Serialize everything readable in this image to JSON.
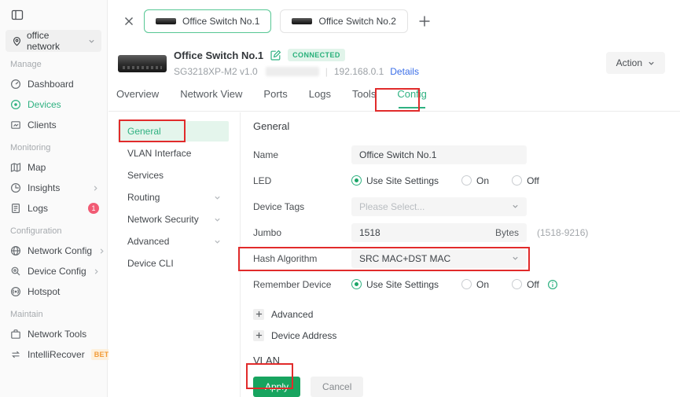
{
  "colors": {
    "accent_green": "#2fb181",
    "button_green": "#18a45f",
    "badge_green_bg": "#e1f4ea",
    "annotation_red": "#e12b2b",
    "logs_badge_red": "#f15b74",
    "beta_orange": "#f29b38",
    "link_blue": "#3a6ee8",
    "sidebar_bg": "#fafafa",
    "field_bg": "#f5f5f5"
  },
  "sidebar": {
    "site": {
      "label": "office network"
    },
    "sections": [
      {
        "label": "Manage",
        "items": [
          {
            "label": "Dashboard"
          },
          {
            "label": "Devices"
          },
          {
            "label": "Clients"
          }
        ]
      },
      {
        "label": "Monitoring",
        "items": [
          {
            "label": "Map"
          },
          {
            "label": "Insights"
          },
          {
            "label": "Logs",
            "badge": "1"
          }
        ]
      },
      {
        "label": "Configuration",
        "items": [
          {
            "label": "Network Config"
          },
          {
            "label": "Device Config"
          },
          {
            "label": "Hotspot"
          }
        ]
      },
      {
        "label": "Maintain",
        "items": [
          {
            "label": "Network Tools"
          },
          {
            "label": "IntelliRecover",
            "beta": "BETA"
          }
        ]
      }
    ]
  },
  "device_tabs": {
    "tabs": [
      {
        "label": "Office Switch No.1",
        "active": true
      },
      {
        "label": "Office Switch No.2",
        "active": false
      }
    ]
  },
  "device_header": {
    "name": "Office Switch No.1",
    "status": "CONNECTED",
    "model": "SG3218XP-M2 v1.0",
    "separator": "|",
    "ip": "192.168.0.1",
    "details_label": "Details",
    "action_label": "Action"
  },
  "page_tabs": {
    "items": [
      {
        "label": "Overview"
      },
      {
        "label": "Network View"
      },
      {
        "label": "Ports"
      },
      {
        "label": "Logs"
      },
      {
        "label": "Tools"
      },
      {
        "label": "Config",
        "active": true
      }
    ]
  },
  "config_nav": {
    "items": [
      {
        "label": "General",
        "active": true
      },
      {
        "label": "VLAN Interface"
      },
      {
        "label": "Services"
      },
      {
        "label": "Routing",
        "expandable": true
      },
      {
        "label": "Network Security",
        "expandable": true
      },
      {
        "label": "Advanced",
        "expandable": true
      },
      {
        "label": "Device CLI"
      }
    ]
  },
  "form": {
    "section_title": "General",
    "name": {
      "label": "Name",
      "value": "Office Switch No.1"
    },
    "led": {
      "label": "LED",
      "options": [
        "Use Site Settings",
        "On",
        "Off"
      ],
      "selected": "Use Site Settings"
    },
    "device_tags": {
      "label": "Device Tags",
      "placeholder": "Please Select..."
    },
    "jumbo": {
      "label": "Jumbo",
      "value": "1518",
      "unit": "Bytes",
      "hint": "(1518-9216)"
    },
    "hash_algorithm": {
      "label": "Hash Algorithm",
      "value": "SRC MAC+DST MAC"
    },
    "remember_device": {
      "label": "Remember Device",
      "options": [
        "Use Site Settings",
        "On",
        "Off"
      ],
      "selected": "Use Site Settings"
    },
    "expanders": [
      {
        "label": "Advanced"
      },
      {
        "label": "Device Address"
      }
    ],
    "vlan_title": "VLAN",
    "apply_label": "Apply",
    "cancel_label": "Cancel"
  }
}
